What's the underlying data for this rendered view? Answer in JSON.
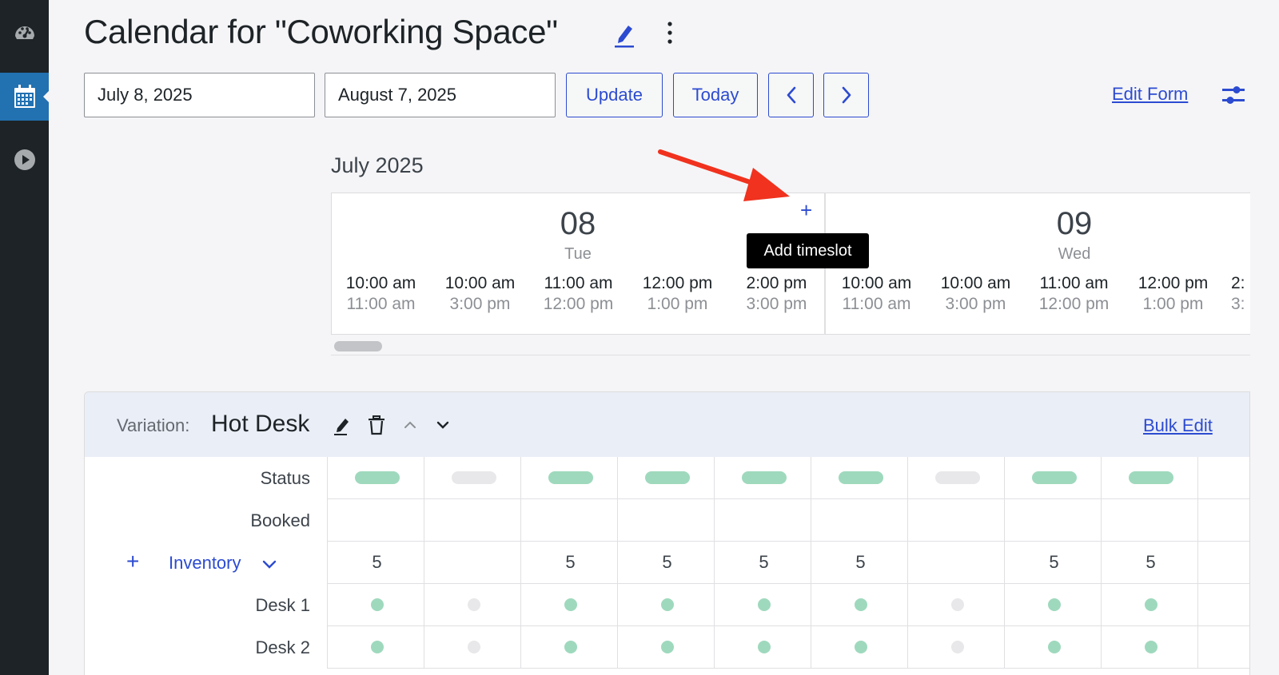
{
  "sidebar": {
    "items": [
      {
        "icon": "dashboard-icon",
        "active": false
      },
      {
        "icon": "calendar-icon",
        "active": true
      },
      {
        "icon": "play-icon",
        "active": false
      }
    ]
  },
  "header": {
    "title": "Calendar for \"Coworking Space\"",
    "start_date": "July 8, 2025",
    "end_date": "August 7, 2025",
    "update_label": "Update",
    "today_label": "Today",
    "edit_form_label": "Edit Form"
  },
  "calendar": {
    "month_label": "July 2025",
    "tooltip": "Add timeslot",
    "add_symbol": "+",
    "days": [
      {
        "num": "08",
        "weekday": "Tue",
        "slots": [
          {
            "start": "10:00 am",
            "end": "11:00 am"
          },
          {
            "start": "10:00 am",
            "end": "3:00 pm"
          },
          {
            "start": "11:00 am",
            "end": "12:00 pm"
          },
          {
            "start": "12:00 pm",
            "end": "1:00 pm"
          },
          {
            "start": "2:00 pm",
            "end": "3:00 pm"
          }
        ]
      },
      {
        "num": "09",
        "weekday": "Wed",
        "slots": [
          {
            "start": "10:00 am",
            "end": "11:00 am"
          },
          {
            "start": "10:00 am",
            "end": "3:00 pm"
          },
          {
            "start": "11:00 am",
            "end": "12:00 pm"
          },
          {
            "start": "12:00 pm",
            "end": "1:00 pm"
          },
          {
            "start": "2:",
            "end": "3:"
          }
        ]
      }
    ]
  },
  "variation": {
    "label": "Variation:",
    "name": "Hot Desk",
    "bulk_edit_label": "Bulk Edit",
    "rows": {
      "status": "Status",
      "booked": "Booked",
      "inventory": "Inventory",
      "inventory_add": "+",
      "desk1": "Desk 1",
      "desk2": "Desk 2"
    },
    "status": [
      "on",
      "off",
      "on",
      "on",
      "on",
      "on",
      "off",
      "on",
      "on"
    ],
    "inventory": [
      "5",
      "",
      "5",
      "5",
      "5",
      "5",
      "",
      "5",
      "5"
    ],
    "desk1": [
      "on",
      "off",
      "on",
      "on",
      "on",
      "on",
      "off",
      "on",
      "on"
    ],
    "desk2": [
      "on",
      "off",
      "on",
      "on",
      "on",
      "on",
      "off",
      "on",
      "on"
    ]
  },
  "colors": {
    "accent": "#2c4bd1",
    "sidebar": "#1d2327",
    "sidebar_active": "#2271b1",
    "available": "#9fd9bd",
    "unavailable": "#e8e8ea",
    "arrow": "#f0321e"
  }
}
